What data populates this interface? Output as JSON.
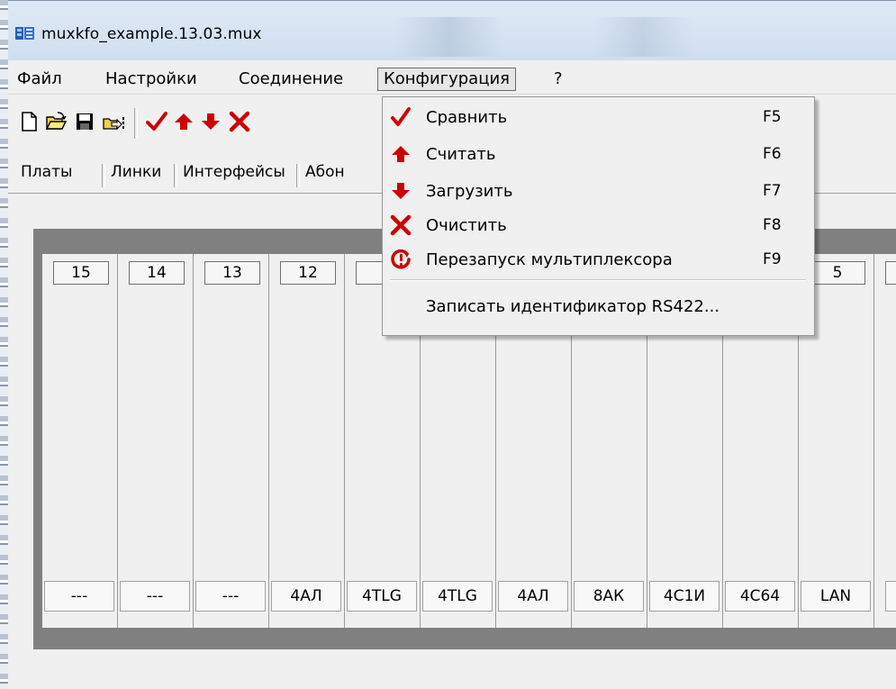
{
  "window": {
    "title": "muxkfo_example.13.03.mux"
  },
  "menu": {
    "items": [
      {
        "label": "Файл"
      },
      {
        "label": "Настройки"
      },
      {
        "label": "Соединение"
      },
      {
        "label": "Конфигурация"
      },
      {
        "label": "?"
      }
    ],
    "open_menu": "Конфигурация"
  },
  "toolbar": {
    "buttons": [
      "new-file-icon",
      "open-folder-icon",
      "save-disk-icon",
      "open-export-icon",
      "check-icon",
      "arrow-up-icon",
      "arrow-down-icon",
      "cross-icon"
    ]
  },
  "tabs": [
    {
      "label": "Платы"
    },
    {
      "label": "Линки"
    },
    {
      "label": "Интерфейсы"
    },
    {
      "label": "Абон"
    }
  ],
  "slots": [
    {
      "number": "15",
      "type": "---"
    },
    {
      "number": "14",
      "type": "---"
    },
    {
      "number": "13",
      "type": "---"
    },
    {
      "number": "12",
      "type": "4АЛ"
    },
    {
      "number": "",
      "type": "4TLG"
    },
    {
      "number": "",
      "type": "4TLG"
    },
    {
      "number": "",
      "type": "4АЛ"
    },
    {
      "number": "",
      "type": "8АК"
    },
    {
      "number": "",
      "type": "4С1И"
    },
    {
      "number": "",
      "type": "4С64"
    },
    {
      "number": "5",
      "type": "LAN"
    },
    {
      "number": "",
      "type": "("
    }
  ],
  "dropdown": {
    "items": [
      {
        "label": "Сравнить",
        "shortcut": "F5",
        "icon": "check-icon"
      },
      {
        "label": "Считать",
        "shortcut": "F6",
        "icon": "arrow-up-icon"
      },
      {
        "label": "Загрузить",
        "shortcut": "F7",
        "icon": "arrow-down-icon"
      },
      {
        "label": "Очистить",
        "shortcut": "F8",
        "icon": "cross-icon"
      },
      {
        "label": "Перезапуск мультиплексора",
        "shortcut": "F9",
        "icon": "restart-icon"
      },
      {
        "label": "Записать идентификатор RS422...",
        "shortcut": "",
        "icon": ""
      }
    ]
  },
  "colors": {
    "accent_red": "#cc0000",
    "rack_frame": "#808080",
    "titlebar": "#d6e3f2"
  }
}
